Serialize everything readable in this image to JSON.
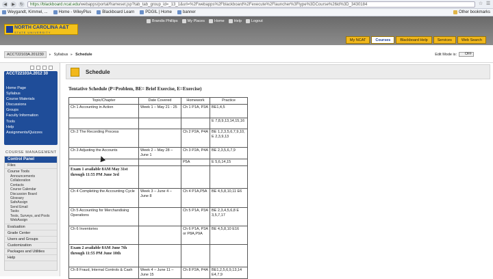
{
  "browser": {
    "url_host": "https://blackboard.ncat.edu",
    "url_path": "/webapps/portal/frameset.jsp?tab_tab_group_id=_13_1&url=%2Fwebapps%2Fblackboard%2Fexecute%2Flauncher%3Ftype%3DCourse%26id%3D_3430184",
    "bookmarks": [
      "Weygandt, Kimmel, ...",
      "Home - WileyPlus",
      "Blackboard Learn",
      "PDGIL | Home",
      "banner"
    ],
    "other_bookmarks": "Other bookmarks"
  },
  "header": {
    "logo_title": "NORTH CAROLINA A&T",
    "logo_sub": "STATE UNIVERSITY",
    "utilities": [
      "Brandis Phillips",
      "My Places",
      "Home",
      "Help",
      "Logout"
    ],
    "tabs": [
      "My NCAT",
      "Courses",
      "Blackboard Help",
      "Services",
      "Web Search"
    ],
    "active_tab": "Courses"
  },
  "breadcrumb": {
    "course": "ACCT22103A.201230",
    "items": [
      "Syllabus",
      "Schedule"
    ]
  },
  "edit_mode": {
    "label": "Edit Mode is:",
    "state": "OFF"
  },
  "course_menu": {
    "title": "ACCT22103A.2012 30",
    "items": [
      "Home Page",
      "Syllabus",
      "Course Materials",
      "Discussions",
      "Groups",
      "Faculty Information",
      "Tools",
      "Help",
      "Assignments/Quizzes"
    ]
  },
  "course_management": {
    "heading": "COURSE MANAGEMENT",
    "control_panel": "Control Panel",
    "files": "Files",
    "course_tools": "Course Tools",
    "tools": [
      "Announcements",
      "Collaboration",
      "Contacts",
      "Course Calendar",
      "Discussion Board",
      "Glossary",
      "SafeAssign",
      "Send Email",
      "Tasks",
      "Tests, Surveys, and Pools",
      "WebAssign"
    ],
    "sections": [
      "Evaluation",
      "Grade Center",
      "Users and Groups",
      "Customization",
      "Packages and Utilities",
      "Help"
    ]
  },
  "page": {
    "title": "Schedule",
    "intro": "Tentative Schedule  (P=Problem, BE= Brief Exercise, E=Exercise)",
    "columns": [
      "Topic/Chapter",
      "Date Covered",
      "Homework",
      "Practice"
    ],
    "rows": [
      {
        "topic": "Ch 1 Accounting in Action",
        "date": "Week 1 – May 21 - 25",
        "hw": "Ch 1 P1A, P3A",
        "practice": "BE1,4,5"
      },
      {
        "topic": "",
        "date": "",
        "hw": "",
        "practice": "E 7,8,9,13,14,15,16"
      },
      {
        "topic": "Ch 2 The Recording Process",
        "date": "",
        "hw": "Ch 2 P2A, P4A",
        "practice": "BE 1,2,3,5,6,7,9,10, E 2,3,9,13"
      },
      {
        "topic": "Ch 3 Adjusting the Accounts",
        "date": "Week 2 – May 28 – June 1",
        "hw": "Ch 3 P2A, P4A",
        "practice": "BE 2,3,5,6,7,9"
      },
      {
        "topic": "",
        "date": "",
        "hw": "P5A",
        "practice": "E 5,6,14,15"
      },
      {
        "topic": "Exam 1  available 8AM May 31st through 11:55 PM June 3rd",
        "date": "",
        "hw": "",
        "practice": "",
        "exam": true
      },
      {
        "topic": "Ch 4 Completing the Accounting Cycle",
        "date": "Week 3 – June 4 – June 8",
        "hw": "Ch 4 P1A,P5A",
        "practice": "BE 4,5,8,10,11 E6"
      },
      {
        "topic": "Ch 5 Accounting for Merchandising Operations",
        "date": "",
        "hw": "Ch 5 P1A, P3A",
        "practice": "BE 2,3,4,5,6,8 E 3,5,7,17"
      },
      {
        "topic": "Ch 6 Inventories",
        "date": "",
        "hw": "Ch 6 P1A, P3A or P8A,P9A",
        "practice": "BE 4,5,8,10 E16"
      },
      {
        "topic": "Exam 2 available 8AM June 7th through 11:55 PM June 10th",
        "date": "",
        "hw": "",
        "practice": "",
        "exam": true
      },
      {
        "topic": "Ch 8 Fraud, Internal Controls & Cash",
        "date": "Week 4 – June 11 – June 15",
        "hw": "Ch 8 P2A, P4A",
        "practice": "BE1,2,5,6,9,13,14 E4,7,9"
      }
    ]
  }
}
